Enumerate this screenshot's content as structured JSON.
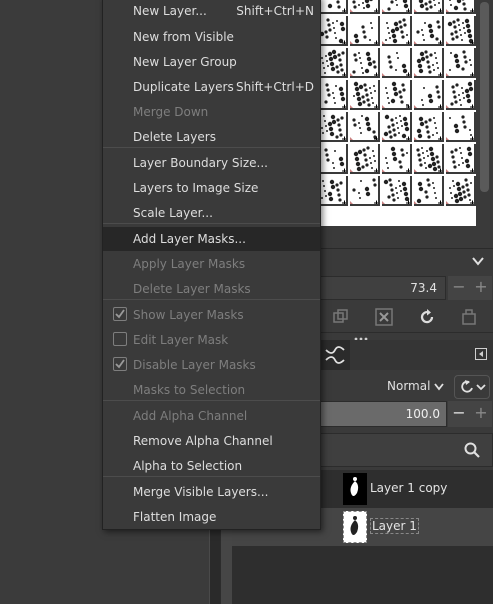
{
  "colors": {
    "menu_bg": "#3a3a3a",
    "menu_highlight": "#272727",
    "disabled_text": "#7e7e7e",
    "enabled_text": "#dedede"
  },
  "menu": {
    "items": [
      {
        "label": "New Layer...",
        "accel": "Shift+Ctrl+N",
        "disabled": false
      },
      {
        "label": "New from Visible",
        "accel": "",
        "disabled": false
      },
      {
        "label": "New Layer Group",
        "accel": "",
        "disabled": false
      },
      {
        "label": "Duplicate Layers",
        "accel": "Shift+Ctrl+D",
        "disabled": false
      },
      {
        "label": "Merge Down",
        "accel": "",
        "disabled": true
      },
      {
        "label": "Delete Layers",
        "accel": "",
        "disabled": false
      },
      {
        "label": "Layer Boundary Size...",
        "accel": "",
        "disabled": false
      },
      {
        "label": "Layers to Image Size",
        "accel": "",
        "disabled": false
      },
      {
        "label": "Scale Layer...",
        "accel": "",
        "disabled": false
      },
      {
        "label": "Add Layer Masks...",
        "accel": "",
        "disabled": false,
        "highlighted": true
      },
      {
        "label": "Apply Layer Masks",
        "accel": "",
        "disabled": true
      },
      {
        "label": "Delete Layer Masks",
        "accel": "",
        "disabled": true
      },
      {
        "label": "Show Layer Masks",
        "accel": "",
        "disabled": true,
        "checkbox": true,
        "checked": true
      },
      {
        "label": "Edit Layer Mask",
        "accel": "",
        "disabled": true,
        "checkbox": true,
        "checked": false
      },
      {
        "label": "Disable Layer Masks",
        "accel": "",
        "disabled": true,
        "checkbox": true,
        "checked": true
      },
      {
        "label": "Masks to Selection",
        "accel": "",
        "disabled": true
      },
      {
        "label": "Add Alpha Channel",
        "accel": "",
        "disabled": true
      },
      {
        "label": "Remove Alpha Channel",
        "accel": "",
        "disabled": false
      },
      {
        "label": "Alpha to Selection",
        "accel": "",
        "disabled": false
      },
      {
        "label": "Merge Visible Layers...",
        "accel": "",
        "disabled": false
      },
      {
        "label": "Flatten Image",
        "accel": "",
        "disabled": false
      }
    ]
  },
  "brush_options": {
    "spacing_value": "73.4"
  },
  "layers_panel": {
    "mode_value": "Normal",
    "opacity_value": "100.0",
    "layers": [
      {
        "name": "Layer 1 copy",
        "selected": false
      },
      {
        "name": "Layer 1",
        "selected": true
      }
    ]
  }
}
